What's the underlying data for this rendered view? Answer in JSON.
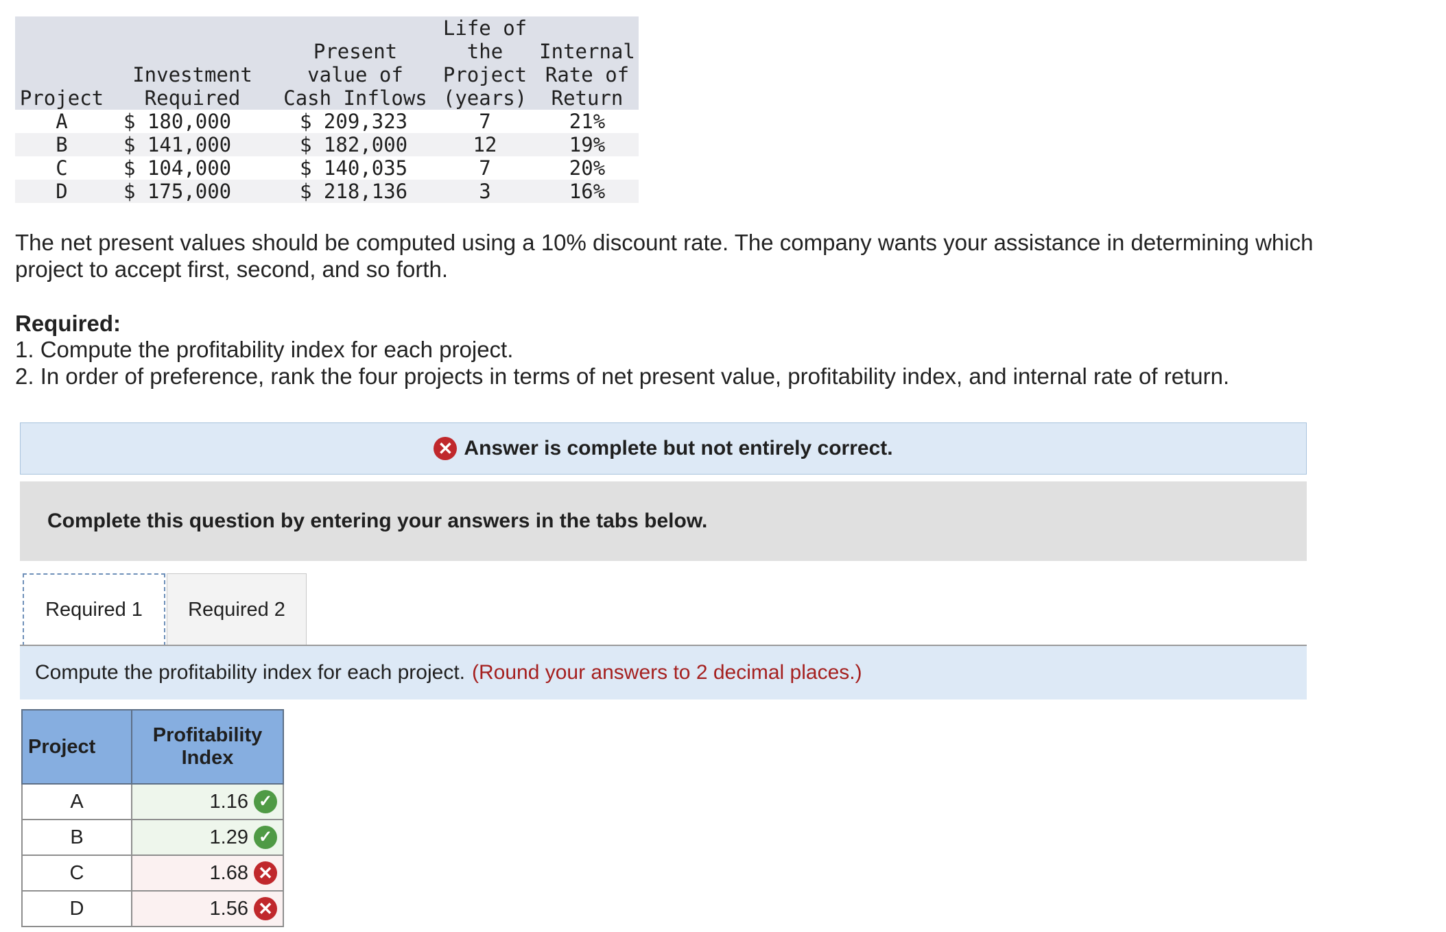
{
  "data_table": {
    "headers": {
      "project": [
        "Project"
      ],
      "investment": [
        "Investment",
        "Required"
      ],
      "pv": [
        "Present",
        "value of",
        "Cash Inflows"
      ],
      "life": [
        "Life of",
        "the",
        "Project",
        "(years)"
      ],
      "irr": [
        "Internal",
        "Rate of",
        "Return"
      ]
    },
    "rows": [
      {
        "project": "A",
        "investment": "$ 180,000",
        "pv": "$ 209,323",
        "life": "7",
        "irr": "21%"
      },
      {
        "project": "B",
        "investment": "$ 141,000",
        "pv": "$ 182,000",
        "life": "12",
        "irr": "19%"
      },
      {
        "project": "C",
        "investment": "$ 104,000",
        "pv": "$ 140,035",
        "life": "7",
        "irr": "20%"
      },
      {
        "project": "D",
        "investment": "$ 175,000",
        "pv": "$ 218,136",
        "life": "3",
        "irr": "16%"
      }
    ]
  },
  "intro": "The net present values should be computed using a 10% discount rate. The company wants your assistance in determining which project to accept first, second, and so forth.",
  "required": {
    "heading": "Required:",
    "item1": "1. Compute the profitability index for each project.",
    "item2": "2. In order of preference, rank the four projects in terms of net present value, profitability index, and internal rate of return."
  },
  "banner": {
    "icon": "x-circle-icon",
    "text": "Answer is complete but not entirely correct."
  },
  "instruction": "Complete this question by entering your answers in the tabs below.",
  "tabs": [
    {
      "label": "Required 1",
      "active": true
    },
    {
      "label": "Required 2",
      "active": false
    }
  ],
  "panel": {
    "prompt": "Compute the profitability index for each project.",
    "note": "(Round your answers to 2 decimal places.)"
  },
  "pi_table": {
    "header_project": "Project",
    "header_pi": [
      "Profitability",
      "Index"
    ],
    "rows": [
      {
        "project": "A",
        "value": "1.16",
        "status": "correct"
      },
      {
        "project": "B",
        "value": "1.29",
        "status": "correct"
      },
      {
        "project": "C",
        "value": "1.68",
        "status": "incorrect"
      },
      {
        "project": "D",
        "value": "1.56",
        "status": "incorrect"
      }
    ]
  },
  "colors": {
    "correct": "#4f9a45",
    "incorrect": "#c0282c",
    "header_blue": "#86aee0",
    "note_red": "#a5201f"
  }
}
